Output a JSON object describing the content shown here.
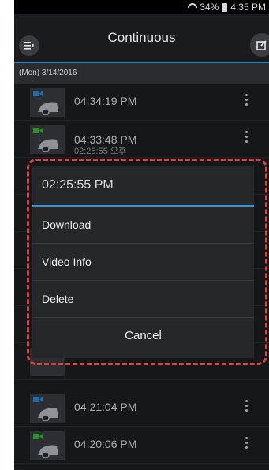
{
  "status_bar": {
    "battery": "34%",
    "time": "4:35 PM"
  },
  "toolbar": {
    "title": "Continuous",
    "menu_icon": "menu-icon",
    "edit_icon": "edit-icon"
  },
  "list": {
    "date_header": "(Mon) 3/14/2016",
    "rows": [
      {
        "time": "04:34:19 PM",
        "tag_color": "#2d8fe0"
      },
      {
        "time": "04:33:48 PM",
        "tag_color": "#39c439",
        "sub": "02:25:55 오후"
      },
      {
        "time": "",
        "tag_color": "#2d8fe0"
      },
      {
        "time": "04:21:04 PM",
        "tag_color": "#2d8fe0"
      },
      {
        "time": "04:20:06 PM",
        "tag_color": "#39c439"
      }
    ]
  },
  "dialog": {
    "title": "02:25:55 PM",
    "options": [
      "Download",
      "Video Info",
      "Delete"
    ],
    "cancel": "Cancel"
  },
  "colors": {
    "accent": "#3a93d6",
    "highlight": "#d64545",
    "background": "#1e1f21"
  }
}
